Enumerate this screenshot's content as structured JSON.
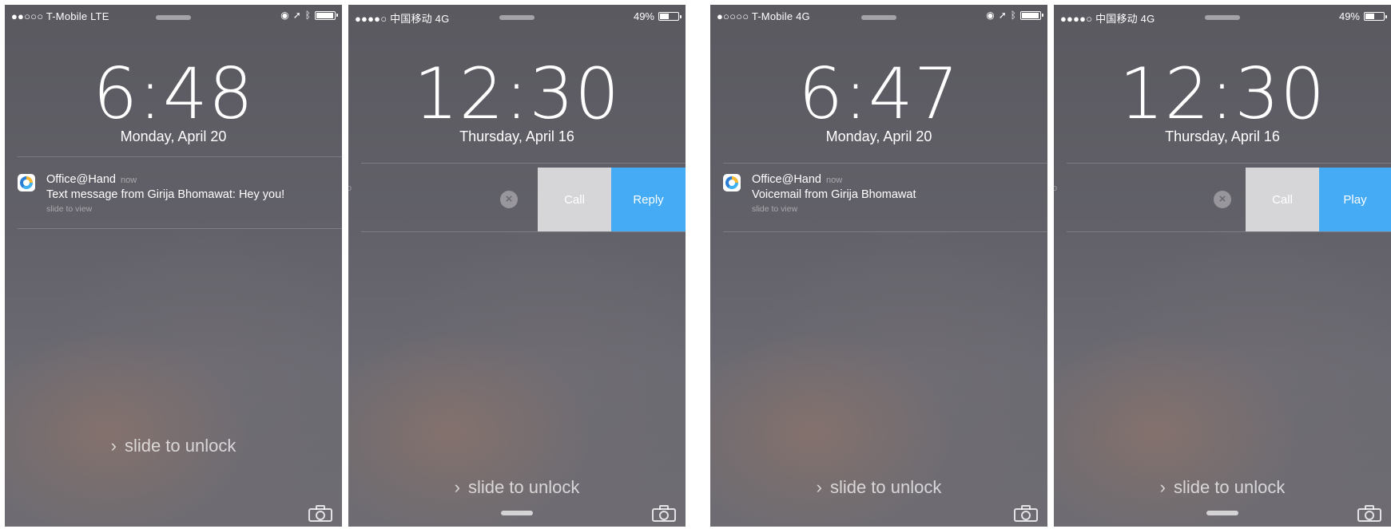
{
  "screens": [
    {
      "carrier": "●●○○○ T-Mobile   LTE",
      "battery_pct": "",
      "battery_level": 0.9,
      "time": "6:48",
      "date": "Monday, April 20",
      "notification": {
        "app": "Office@Hand",
        "time_tag": "now",
        "message": "Text message from Girija Bhomawat: Hey you!",
        "hint": "slide to view"
      },
      "unlock": "slide to unlock"
    },
    {
      "carrier": "●●●●○ 中国移动   4G",
      "battery_pct": "49%",
      "battery_level": 0.49,
      "time": "12:30",
      "date": "Thursday, April 16",
      "actions": {
        "clear": "×",
        "call": "Call",
        "primary": "Reply"
      },
      "unlock": "slide to unlock"
    },
    {
      "carrier": "●○○○○ T-Mobile   4G",
      "battery_pct": "",
      "battery_level": 0.9,
      "time": "6:47",
      "date": "Monday, April 20",
      "notification": {
        "app": "Office@Hand",
        "time_tag": "now",
        "message": "Voicemail from Girija Bhomawat",
        "hint": "slide to view"
      },
      "unlock": "slide to unlock"
    },
    {
      "carrier": "●●●●○ 中国移动   4G",
      "battery_pct": "49%",
      "battery_level": 0.49,
      "time": "12:30",
      "date": "Thursday, April 16",
      "actions": {
        "clear": "×",
        "call": "Call",
        "primary": "Play"
      },
      "unlock": "slide to unlock"
    }
  ],
  "icons": {
    "status_left_phones": [
      "location-icon",
      "arrow-icon",
      "bluetooth-icon",
      "battery-icon"
    ],
    "notification_app": "office-at-hand-app-icon",
    "unlock_chevron": "chevron-right-icon",
    "camera": "camera-icon"
  },
  "colors": {
    "reply_play_bg": "#45abf5",
    "call_bg": "#d6d6d8"
  }
}
